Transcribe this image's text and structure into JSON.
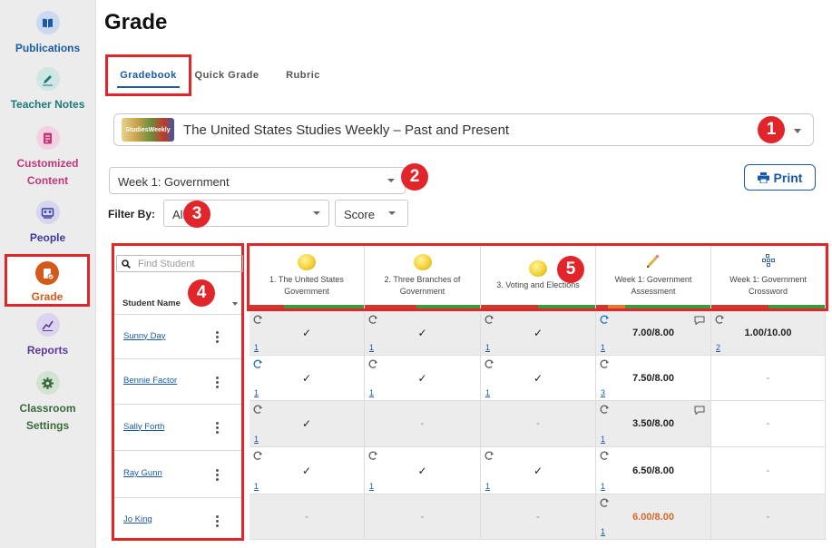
{
  "sidebar": {
    "items": [
      {
        "label": "Publications",
        "icon": "book-icon",
        "color": "#1a5aa8",
        "bg": "#cdd9ee"
      },
      {
        "label": "Teacher Notes",
        "icon": "pen-icon",
        "color": "#1c7a7a",
        "bg": "#cfe6e3"
      },
      {
        "label": "Customized Content",
        "icon": "document-icon",
        "color": "#c2377a",
        "bg": "#f3d1e2"
      },
      {
        "label": "People",
        "icon": "people-icon",
        "color": "#3a3aa0",
        "bg": "#d6d6ee"
      },
      {
        "label": "Grade",
        "icon": "grade-icon",
        "color": "#d25a1a",
        "bg": "#d25a1a",
        "active": true
      },
      {
        "label": "Reports",
        "icon": "chart-icon",
        "color": "#5a3aa0",
        "bg": "#dcd3ee"
      },
      {
        "label": "Classroom Settings",
        "icon": "gear-icon",
        "color": "#3a6a3a",
        "bg": "#d3e3d3"
      }
    ]
  },
  "page": {
    "title": "Grade"
  },
  "tabs": [
    {
      "label": "Gradebook",
      "active": true
    },
    {
      "label": "Quick Grade"
    },
    {
      "label": "Rubric"
    }
  ],
  "publication": {
    "title": "The United States Studies Weekly – Past and Present",
    "thumb_text": "StudiesWeekly"
  },
  "week_select": {
    "value": "Week 1: Government"
  },
  "print_button": {
    "label": "Print"
  },
  "filter": {
    "label": "Filter By:",
    "value": "All",
    "score_value": "Score"
  },
  "callouts": [
    "1",
    "2",
    "3",
    "4",
    "5"
  ],
  "search": {
    "placeholder": "Find Student"
  },
  "student_header": "Student Name",
  "students": [
    "Sunny Day",
    "Bennie Factor",
    "Sally Forth",
    "Ray Gunn",
    "Jo King"
  ],
  "assignments": [
    {
      "title": "1. The United States Government",
      "icon": "coin-icon"
    },
    {
      "title": "2. Three Branches of Government",
      "icon": "coin-icon"
    },
    {
      "title": "3. Voting and Elections",
      "icon": "coin-icon"
    },
    {
      "title": "Week 1: Government Assessment",
      "icon": "pencil-icon"
    },
    {
      "title": "Week 1: Government Crossword",
      "icon": "crossword-icon"
    }
  ],
  "grades": [
    [
      {
        "mark": "✓",
        "attempt": "1"
      },
      {
        "mark": "✓",
        "attempt": "1"
      },
      {
        "mark": "✓",
        "attempt": "1"
      },
      {
        "score": "7.00/8.00",
        "attempt": "1",
        "comment": true,
        "refresh_blue": true
      },
      {
        "score": "1.00/10.00",
        "attempt": "2"
      }
    ],
    [
      {
        "mark": "✓",
        "attempt": "1",
        "refresh_blue": true
      },
      {
        "mark": "✓",
        "attempt": "1"
      },
      {
        "mark": "✓",
        "attempt": "1"
      },
      {
        "score": "7.50/8.00",
        "attempt": "3"
      },
      {
        "dash": "-"
      }
    ],
    [
      {
        "mark": "✓",
        "attempt": "1"
      },
      {
        "dash": "-"
      },
      {
        "dash": "-"
      },
      {
        "score": "3.50/8.00",
        "attempt": "1",
        "comment": true
      },
      {
        "dash": "-"
      }
    ],
    [
      {
        "mark": "✓",
        "attempt": "1"
      },
      {
        "mark": "✓",
        "attempt": "1"
      },
      {
        "mark": "✓",
        "attempt": "1"
      },
      {
        "score": "6.50/8.00",
        "attempt": "1"
      },
      {
        "dash": "-"
      }
    ],
    [
      {
        "dash": "-"
      },
      {
        "dash": "-"
      },
      {
        "dash": "-"
      },
      {
        "score": "6.00/8.00",
        "attempt": "1",
        "warn": true
      },
      {
        "dash": "-"
      }
    ]
  ],
  "colors": {
    "accent": "#1a5aa8",
    "highlight": "#e0262a",
    "warn": "#d96a2a"
  }
}
